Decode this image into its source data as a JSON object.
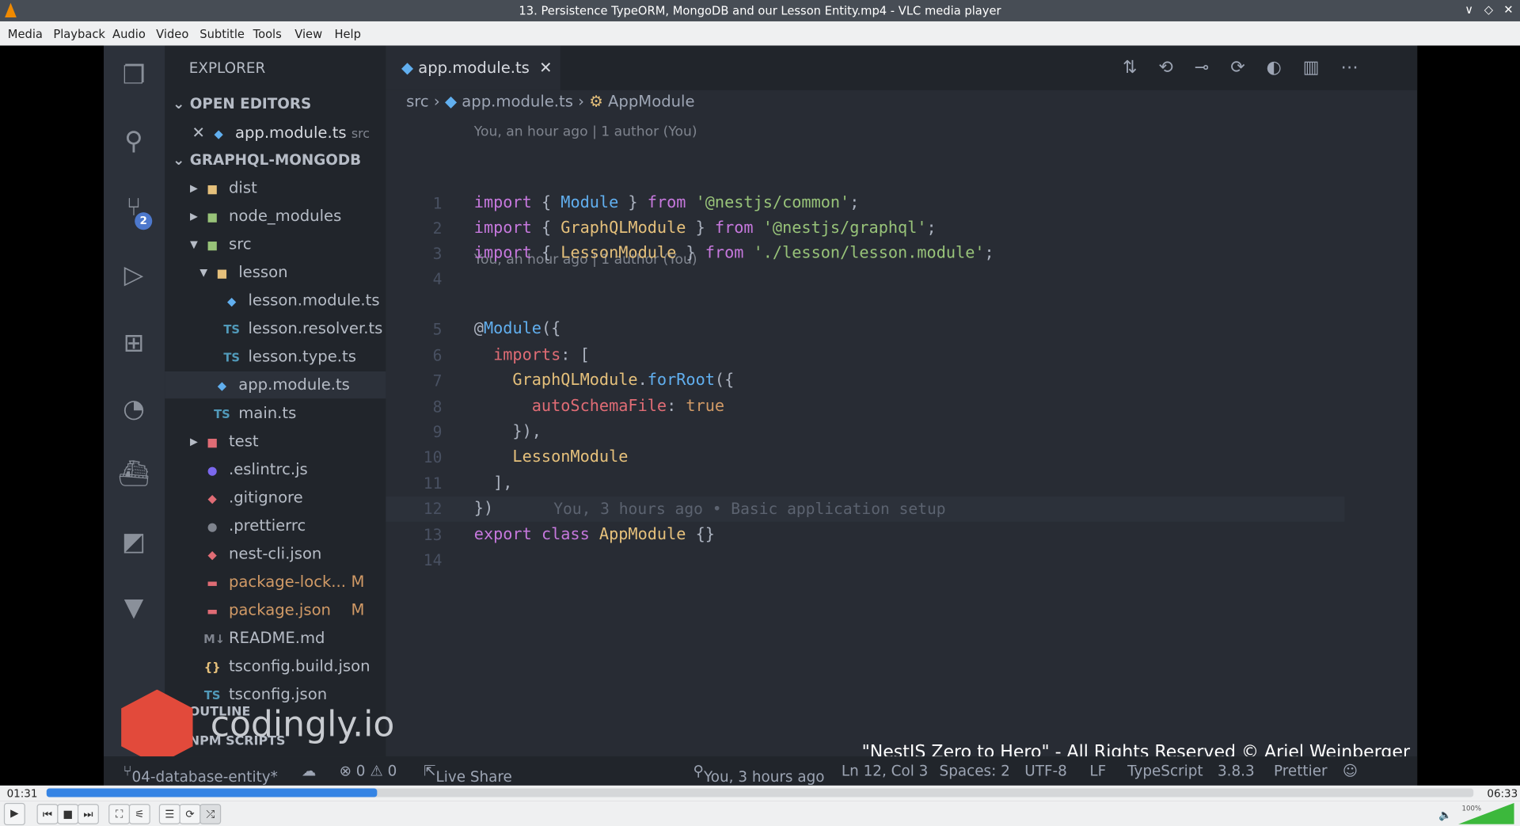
{
  "window": {
    "title": "13. Persistence TypeORM, MongoDB and our Lesson Entity.mp4 - VLC media player",
    "controls": [
      "∨",
      "◇",
      "✕"
    ]
  },
  "menu": [
    "Media",
    "Playback",
    "Audio",
    "Video",
    "Subtitle",
    "Tools",
    "View",
    "Help"
  ],
  "vscode": {
    "explorer_title": "EXPLORER",
    "open_editors": "OPEN EDITORS",
    "open_file": {
      "name": "app.module.ts",
      "dir": "src"
    },
    "project": "GRAPHQL-MONGODB",
    "tree": [
      {
        "name": "dist",
        "kind": "folder",
        "depth": 1,
        "icon": "▸",
        "color": "#e5c07b"
      },
      {
        "name": "node_modules",
        "kind": "folder",
        "depth": 1,
        "icon": "▸",
        "color": "#98c379"
      },
      {
        "name": "src",
        "kind": "folder-open",
        "depth": 1,
        "icon": "▾",
        "color": "#98c379"
      },
      {
        "name": "lesson",
        "kind": "folder-open",
        "depth": 2,
        "icon": "▾",
        "color": "#e5c07b"
      },
      {
        "name": "lesson.module.ts",
        "kind": "nest",
        "depth": 3,
        "color": "#61afef"
      },
      {
        "name": "lesson.resolver.ts",
        "kind": "ts",
        "depth": 3,
        "color": "#519aba"
      },
      {
        "name": "lesson.type.ts",
        "kind": "ts",
        "depth": 3,
        "color": "#519aba"
      },
      {
        "name": "app.module.ts",
        "kind": "nest",
        "depth": 2,
        "color": "#61afef",
        "selected": true
      },
      {
        "name": "main.ts",
        "kind": "ts",
        "depth": 2,
        "color": "#519aba"
      },
      {
        "name": "test",
        "kind": "folder",
        "depth": 1,
        "icon": "▸",
        "color": "#e06c75"
      },
      {
        "name": ".eslintrc.js",
        "kind": "config",
        "depth": 1,
        "color": "#7b68ee"
      },
      {
        "name": ".gitignore",
        "kind": "git",
        "depth": 1,
        "color": "#e06c75"
      },
      {
        "name": ".prettierrc",
        "kind": "config",
        "depth": 1,
        "color": "#7f848e"
      },
      {
        "name": "nest-cli.json",
        "kind": "nest",
        "depth": 1,
        "color": "#e06c75"
      },
      {
        "name": "package-lock...",
        "kind": "npm",
        "depth": 1,
        "color": "#e06c75",
        "badge": "M",
        "modified": true
      },
      {
        "name": "package.json",
        "kind": "npm",
        "depth": 1,
        "color": "#e06c75",
        "badge": "M",
        "modified": true
      },
      {
        "name": "README.md",
        "kind": "md",
        "depth": 1,
        "color": "#7f848e"
      },
      {
        "name": "tsconfig.build.json",
        "kind": "json",
        "depth": 1,
        "color": "#e5c07b"
      },
      {
        "name": "tsconfig.json",
        "kind": "ts",
        "depth": 1,
        "color": "#519aba"
      }
    ],
    "outline": "OUTLINE",
    "npm_scripts": "NPM SCRIPTS",
    "tab": "app.module.ts",
    "breadcrumb": [
      "src",
      "app.module.ts",
      "AppModule"
    ],
    "scm_badge": "2",
    "blame": [
      "You, an hour ago | 1 author (You)",
      "You, an hour ago | 1 author (You)"
    ],
    "inline_blame": "You, 3 hours ago • Basic application setup",
    "lines": [
      [
        [
          "import ",
          "#c678dd"
        ],
        [
          "{ ",
          "#abb2bf"
        ],
        [
          "Module",
          "#61afef"
        ],
        [
          " } ",
          "#abb2bf"
        ],
        [
          "from ",
          "#c678dd"
        ],
        [
          "'@nestjs/common'",
          "#98c379"
        ],
        [
          ";",
          "#abb2bf"
        ]
      ],
      [
        [
          "import ",
          "#c678dd"
        ],
        [
          "{ ",
          "#abb2bf"
        ],
        [
          "GraphQLModule",
          "#e5c07b"
        ],
        [
          " } ",
          "#abb2bf"
        ],
        [
          "from ",
          "#c678dd"
        ],
        [
          "'@nestjs/graphql'",
          "#98c379"
        ],
        [
          ";",
          "#abb2bf"
        ]
      ],
      [
        [
          "import ",
          "#c678dd"
        ],
        [
          "{ ",
          "#abb2bf"
        ],
        [
          "LessonModule",
          "#e5c07b"
        ],
        [
          " } ",
          "#abb2bf"
        ],
        [
          "from ",
          "#c678dd"
        ],
        [
          "'./lesson/lesson.module'",
          "#98c379"
        ],
        [
          ";",
          "#abb2bf"
        ]
      ],
      [],
      [
        [
          "@",
          "#abb2bf"
        ],
        [
          "Module",
          "#61afef"
        ],
        [
          "({",
          "#abb2bf"
        ]
      ],
      [
        [
          "  imports",
          "#e06c75"
        ],
        [
          ": [",
          "#abb2bf"
        ]
      ],
      [
        [
          "    GraphQLModule",
          "#e5c07b"
        ],
        [
          ".",
          "#abb2bf"
        ],
        [
          "forRoot",
          "#61afef"
        ],
        [
          "({",
          "#abb2bf"
        ]
      ],
      [
        [
          "      autoSchemaFile",
          "#e06c75"
        ],
        [
          ": ",
          "#abb2bf"
        ],
        [
          "true",
          "#d19a66"
        ]
      ],
      [
        [
          "    }),",
          "#abb2bf"
        ]
      ],
      [
        [
          "    LessonModule",
          "#e5c07b"
        ]
      ],
      [
        [
          "  ],",
          "#abb2bf"
        ]
      ],
      [
        [
          "})",
          "#abb2bf"
        ]
      ],
      [
        [
          "export ",
          "#c678dd"
        ],
        [
          "class ",
          "#c678dd"
        ],
        [
          "AppModule",
          "#e5c07b"
        ],
        [
          " {}",
          "#abb2bf"
        ]
      ],
      []
    ],
    "status": {
      "branch": "04-database-entity*",
      "problems": "⊗ 0 ⚠ 0",
      "live_share": "Live Share",
      "blame": "You, 3 hours ago",
      "position": "Ln 12, Col 3",
      "spaces": "Spaces: 2",
      "encoding": "UTF-8",
      "eol": "LF",
      "language": "TypeScript",
      "ts_version": "3.8.3",
      "formatter": "Prettier"
    }
  },
  "watermark": {
    "brand": "codingly.io",
    "copyright": "\"NestJS Zero to Hero\" - All Rights Reserved © Ariel Weinberger"
  },
  "player": {
    "elapsed": "01:31",
    "total": "06:33",
    "progress": 0.2316,
    "volume_label": "100%",
    "volume": 1.0,
    "accent": "#3584e4"
  }
}
